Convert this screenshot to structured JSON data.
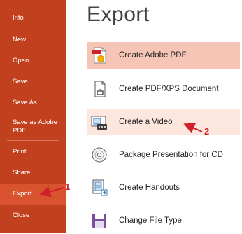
{
  "sidebar": {
    "items": [
      {
        "label": "Info"
      },
      {
        "label": "New"
      },
      {
        "label": "Open"
      },
      {
        "label": "Save"
      },
      {
        "label": "Save As"
      },
      {
        "label": "Save as Adobe PDF"
      },
      {
        "label": "Print"
      },
      {
        "label": "Share"
      },
      {
        "label": "Export"
      },
      {
        "label": "Close"
      }
    ],
    "active": "Export"
  },
  "main": {
    "title": "Export",
    "options": [
      {
        "label": "Create Adobe PDF",
        "icon": "adobe-pdf-icon",
        "state": "selected"
      },
      {
        "label": "Create PDF/XPS Document",
        "icon": "pdf-xps-document-icon"
      },
      {
        "label": "Create a Video",
        "icon": "video-icon",
        "state": "hover"
      },
      {
        "label": "Package Presentation for CD",
        "icon": "cd-icon"
      },
      {
        "label": "Create Handouts",
        "icon": "handouts-icon"
      },
      {
        "label": "Change File Type",
        "icon": "file-type-icon"
      }
    ]
  },
  "annotations": {
    "marker_1": "1",
    "marker_2": "2",
    "color": "#d0202a"
  },
  "colors": {
    "sidebar": "#c1401d",
    "sidebar_active": "#d8532e",
    "option_selected": "#f6c5b5",
    "option_hover": "#fde6dd"
  }
}
